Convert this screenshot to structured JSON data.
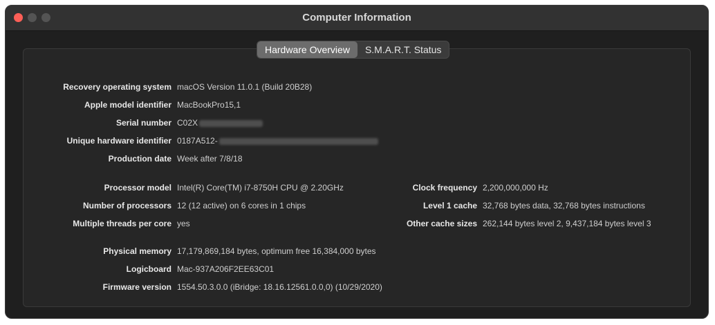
{
  "window": {
    "title": "Computer Information"
  },
  "tabs": [
    {
      "label": "Hardware Overview",
      "active": true
    },
    {
      "label": "S.M.A.R.T. Status",
      "active": false
    }
  ],
  "info": {
    "recovery_os": {
      "label": "Recovery operating system",
      "value": "macOS Version 11.0.1 (Build 20B28)"
    },
    "model_id": {
      "label": "Apple model identifier",
      "value": "MacBookPro15,1"
    },
    "serial": {
      "label": "Serial number",
      "value": "C02X"
    },
    "hardware_uuid": {
      "label": "Unique hardware identifier",
      "value": "0187A512-"
    },
    "production_date": {
      "label": "Production date",
      "value": "Week after 7/8/18"
    },
    "processor_model": {
      "label": "Processor model",
      "value": "Intel(R) Core(TM) i7-8750H CPU @ 2.20GHz"
    },
    "num_processors": {
      "label": "Number of processors",
      "value": "12 (12 active) on 6 cores in 1 chips"
    },
    "threads_per_core": {
      "label": "Multiple threads per core",
      "value": "yes"
    },
    "clock_frequency": {
      "label": "Clock frequency",
      "value": "2,200,000,000 Hz"
    },
    "l1_cache": {
      "label": "Level 1 cache",
      "value": "32,768 bytes data, 32,768 bytes instructions"
    },
    "other_cache": {
      "label": "Other cache sizes",
      "value": "262,144 bytes level 2, 9,437,184 bytes level 3"
    },
    "physical_memory": {
      "label": "Physical memory",
      "value": "17,179,869,184 bytes, optimum free 16,384,000 bytes"
    },
    "logicboard": {
      "label": "Logicboard",
      "value": "Mac-937A206F2EE63C01"
    },
    "firmware": {
      "label": "Firmware version",
      "value": "1554.50.3.0.0 (iBridge: 18.16.12561.0.0,0) (10/29/2020)"
    }
  },
  "colors": {
    "window_bg": "#1f1f1f",
    "titlebar_bg": "#323232",
    "close_button": "#fe5f57",
    "inactive_button": "#545454",
    "active_tab": "#6c6c6c"
  }
}
